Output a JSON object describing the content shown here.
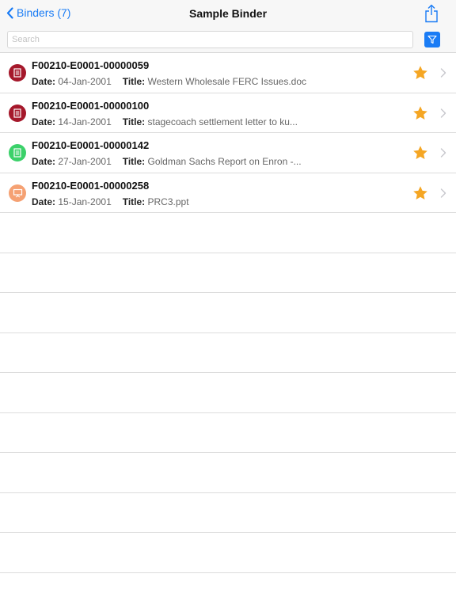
{
  "navbar": {
    "back_label": "Binders (7)",
    "title": "Sample Binder",
    "accent_color": "#1a7cf5"
  },
  "search": {
    "placeholder": "Search"
  },
  "documents": [
    {
      "id": "F00210-E0001-00000059",
      "date_label": "Date:",
      "date": "04-Jan-2001",
      "title_label": "Title:",
      "title": "Western Wholesale FERC Issues.doc",
      "icon": "document-icon",
      "icon_color": "#a5182b",
      "starred": true
    },
    {
      "id": "F00210-E0001-00000100",
      "date_label": "Date:",
      "date": "14-Jan-2001",
      "title_label": "Title:",
      "title": "stagecoach settlement letter to ku...",
      "icon": "document-icon",
      "icon_color": "#a5182b",
      "starred": true
    },
    {
      "id": "F00210-E0001-00000142",
      "date_label": "Date:",
      "date": "27-Jan-2001",
      "title_label": "Title:",
      "title": "Goldman Sachs Report on Enron -...",
      "icon": "spreadsheet-icon",
      "icon_color": "#3bd16a",
      "starred": true
    },
    {
      "id": "F00210-E0001-00000258",
      "date_label": "Date:",
      "date": "15-Jan-2001",
      "title_label": "Title:",
      "title": "PRC3.ppt",
      "icon": "presentation-icon",
      "icon_color": "#f5a173",
      "starred": true
    }
  ],
  "colors": {
    "star": "#f5a623",
    "separator": "#dcdcdc"
  }
}
